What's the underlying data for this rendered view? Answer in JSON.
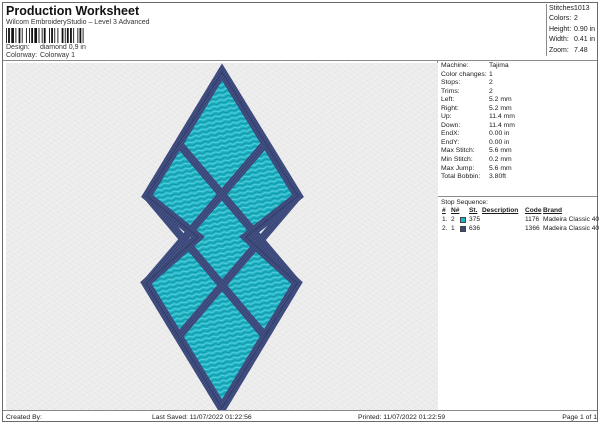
{
  "header": {
    "title": "Production Worksheet",
    "subtitle": "Wilcom EmbroideryStudio – Level 3 Advanced",
    "design_label": "Design:",
    "design_value": "diamond 0,9 in",
    "colorway_label": "Colorway:",
    "colorway_value": "Colorway 1"
  },
  "summary": [
    {
      "label": "Stitches:",
      "value": "1013"
    },
    {
      "label": "Colors:",
      "value": "2"
    },
    {
      "label": "Height:",
      "value": "0.90 in"
    },
    {
      "label": "Width:",
      "value": "0.41 in"
    },
    {
      "label": "Zoom:",
      "value": "7.48"
    }
  ],
  "details": [
    {
      "label": "Machine:",
      "value": "Tajima"
    },
    {
      "label": "Color changes:",
      "value": "1"
    },
    {
      "label": "Stops:",
      "value": "2"
    },
    {
      "label": "Trims:",
      "value": "2"
    },
    {
      "label": "Left:",
      "value": "5.2 mm"
    },
    {
      "label": "Right:",
      "value": "5.2 mm"
    },
    {
      "label": "Up:",
      "value": "11.4 mm"
    },
    {
      "label": "Down:",
      "value": "11.4 mm"
    },
    {
      "label": "EndX:",
      "value": "0.00 in"
    },
    {
      "label": "EndY:",
      "value": "0.00 in"
    },
    {
      "label": "Max Stitch:",
      "value": "5.6 mm"
    },
    {
      "label": "Min Stitch:",
      "value": "0.2 mm"
    },
    {
      "label": "Max Jump:",
      "value": "5.6 mm"
    },
    {
      "label": "Total Bobbin:",
      "value": "3.80ft"
    }
  ],
  "stop_sequence": {
    "label": "Stop Sequence:",
    "headers": {
      "num": "#",
      "n": "N#",
      "st": "St.",
      "desc": "Description",
      "code": "Code",
      "brand": "Brand"
    },
    "rows": [
      {
        "num": "1.",
        "n": "2",
        "color": "#1eb3c4",
        "st": "375",
        "desc": "",
        "code": "1176",
        "brand": "Madeira Classic 40"
      },
      {
        "num": "2.",
        "n": "1",
        "color": "#3d4a78",
        "st": "636",
        "desc": "",
        "code": "1366",
        "brand": "Madeira Classic 40"
      }
    ]
  },
  "footer": {
    "created_by": "Created By:",
    "last_saved": "Last Saved: 11/07/2022 01:22:56",
    "printed": "Printed: 11/07/2022 01:22:59",
    "page": "Page 1 of 1"
  },
  "colors": {
    "fill": "#1eb3c4",
    "outline": "#3d4a78",
    "outline_dark": "#2a3358"
  }
}
